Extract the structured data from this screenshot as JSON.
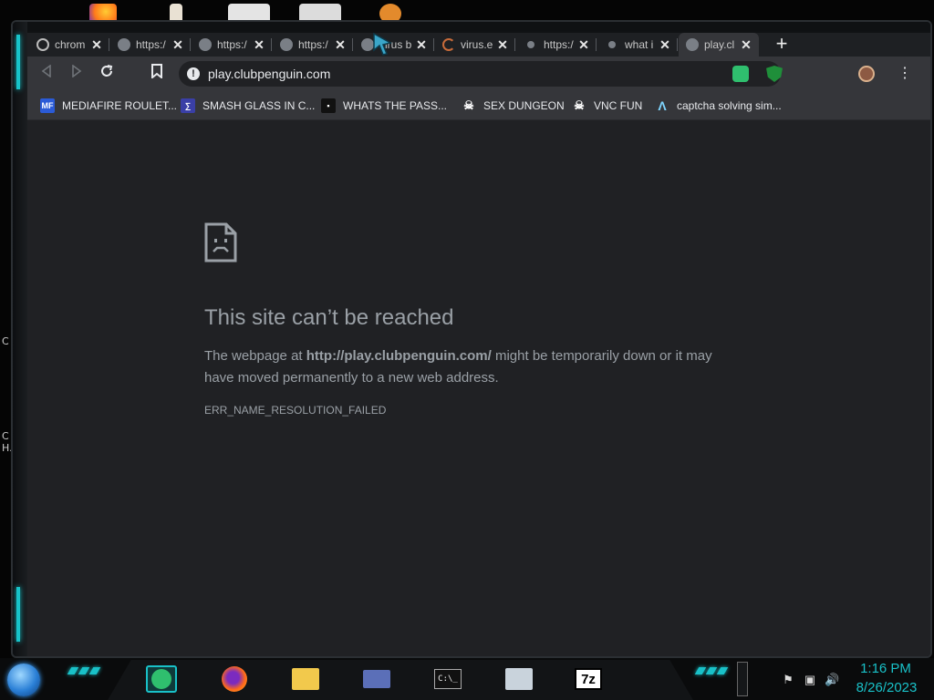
{
  "browser": {
    "tabs": [
      {
        "title": "chrom",
        "icon": "history-icon"
      },
      {
        "title": "https:/",
        "icon": "globe-icon"
      },
      {
        "title": "https:/",
        "icon": "globe-icon"
      },
      {
        "title": "https:/",
        "icon": "globe-icon"
      },
      {
        "title": "virus b",
        "icon": "globe-icon"
      },
      {
        "title": "virus.e",
        "icon": "spinner-icon"
      },
      {
        "title": "https:/",
        "icon": "globe-icon"
      },
      {
        "title": "what i",
        "icon": "globe-icon"
      },
      {
        "title": "play.cl",
        "icon": "globe-icon"
      }
    ],
    "close_glyph": "✕",
    "new_tab_glyph": "+",
    "url": "play.clubpenguin.com",
    "bookmarks": [
      {
        "label": "MEDIAFIRE ROULET...",
        "icon_text": "MF",
        "icon_color": "#2b5bd7"
      },
      {
        "label": "SMASH GLASS IN C...",
        "icon_text": "∑",
        "icon_color": "#3a3fa6"
      },
      {
        "label": "WHATS THE PASS...",
        "icon_text": "▪",
        "icon_color": "#111111"
      },
      {
        "label": "SEX DUNGEON",
        "icon_text": "☠",
        "icon_color": "#35363a"
      },
      {
        "label": "VNC FUN",
        "icon_text": "☠",
        "icon_color": "#35363a"
      },
      {
        "label": "captcha solving sim...",
        "icon_text": "Λ",
        "icon_color": "#35363a"
      }
    ]
  },
  "error_page": {
    "title": "This site can’t be reached",
    "body_prefix": "The webpage at ",
    "body_url": "http://play.clubpenguin.com/",
    "body_suffix": " might be temporarily down or it may have moved permanently to a new web address.",
    "error_code": "ERR_NAME_RESOLUTION_FAILED"
  },
  "desktop": {
    "side_text_1": "C",
    "side_text_2": "C\nH."
  },
  "taskbar": {
    "apps": [
      "notes-icon",
      "firefox-icon",
      "file-explorer-icon",
      "card-icon",
      "terminal-icon",
      "network-icon",
      "7zip-icon"
    ],
    "terminal_text": "C:\\_",
    "sevenzip_text": "7z",
    "time": "1:16 PM",
    "date": "8/26/2023"
  },
  "colors": {
    "accent": "#19c1c8",
    "page_bg": "#202124",
    "toolbar": "#35363a"
  }
}
